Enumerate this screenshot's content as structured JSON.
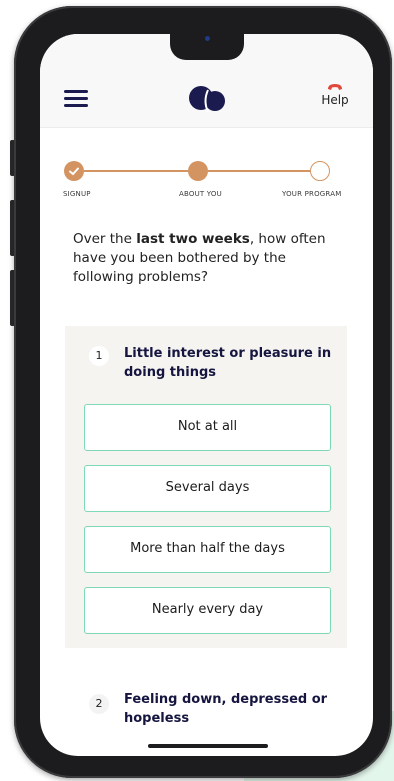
{
  "header": {
    "menu_icon": "hamburger-icon",
    "logo_icon": "brand-logo-icon",
    "help_icon": "phone-icon",
    "help_label": "Help"
  },
  "stepper": {
    "accent_color": "#d39461",
    "steps": [
      {
        "label": "SIGNUP",
        "state": "done"
      },
      {
        "label": "ABOUT YOU",
        "state": "current"
      },
      {
        "label": "YOUR PROGRAM",
        "state": "upcoming"
      }
    ]
  },
  "intro": {
    "prefix": "Over the ",
    "bold": "last two weeks",
    "suffix": ", how often have you been bothered by the following problems?"
  },
  "questions": [
    {
      "number": "1",
      "text": "Little interest or pleasure in doing things",
      "options": [
        "Not at all",
        "Several days",
        "More than half the days",
        "Nearly every day"
      ]
    },
    {
      "number": "2",
      "text": "Feeling down, depressed or hopeless"
    }
  ],
  "colors": {
    "option_border": "#7fd9b6",
    "navy": "#15153f",
    "help_icon": "#e0483c"
  }
}
